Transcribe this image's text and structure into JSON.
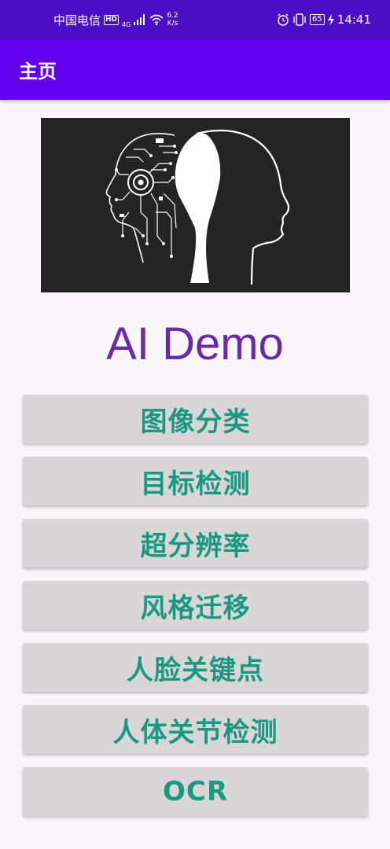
{
  "status_bar": {
    "carrier": "中国电信",
    "hd": "HD",
    "network": "4G",
    "speed_value": "6.2",
    "speed_unit": "K/s",
    "battery": "65",
    "time": "14:41",
    "icons": [
      "hd-icon",
      "signal-icon",
      "wifi-icon",
      "alarm-icon",
      "vibrate-icon",
      "battery-icon",
      "charging-icon"
    ]
  },
  "app_bar": {
    "title": "主页"
  },
  "hero": {
    "image": "ai-head-illustration"
  },
  "headline": "AI Demo",
  "buttons": [
    {
      "label": "图像分类"
    },
    {
      "label": "目标检测"
    },
    {
      "label": "超分辨率"
    },
    {
      "label": "风格迁移"
    },
    {
      "label": "人脸关键点"
    },
    {
      "label": "人体关节检测"
    },
    {
      "label": "OCR"
    }
  ],
  "colors": {
    "status_bar": "#4a0ec4",
    "app_bar": "#6200ee",
    "headline": "#6a2aa8",
    "button_bg": "#d8d6d6",
    "button_text": "#1a9980"
  }
}
